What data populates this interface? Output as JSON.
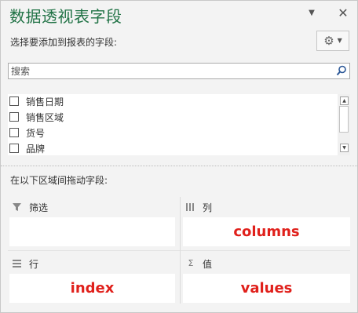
{
  "panel": {
    "title": "数据透视表字段",
    "choose_fields_label": "选择要添加到报表的字段:",
    "accent_color": "#217346"
  },
  "header_controls": {
    "dropdown_icon": "chevron-down-icon",
    "close_icon": "close-icon",
    "close_glyph": "✕",
    "dropdown_glyph": "▼"
  },
  "tools_button": {
    "icon": "gear-icon",
    "glyph": "⚙",
    "caret": "▼"
  },
  "search": {
    "placeholder": "搜索",
    "value": ""
  },
  "fields": [
    {
      "label": "销售日期",
      "checked": false
    },
    {
      "label": "销售区域",
      "checked": false
    },
    {
      "label": "货号",
      "checked": false
    },
    {
      "label": "品牌",
      "checked": false
    }
  ],
  "drag_label": "在以下区域间拖动字段:",
  "areas": {
    "filters": {
      "label": "筛选",
      "icon": "filter-icon",
      "content": ""
    },
    "columns": {
      "label": "列",
      "icon": "columns-icon",
      "content": "columns"
    },
    "rows": {
      "label": "行",
      "icon": "rows-icon",
      "content": "index"
    },
    "values": {
      "label": "值",
      "icon": "sigma-icon",
      "icon_glyph": "Σ",
      "content": "values"
    }
  },
  "annotation_color": "#e0201b"
}
